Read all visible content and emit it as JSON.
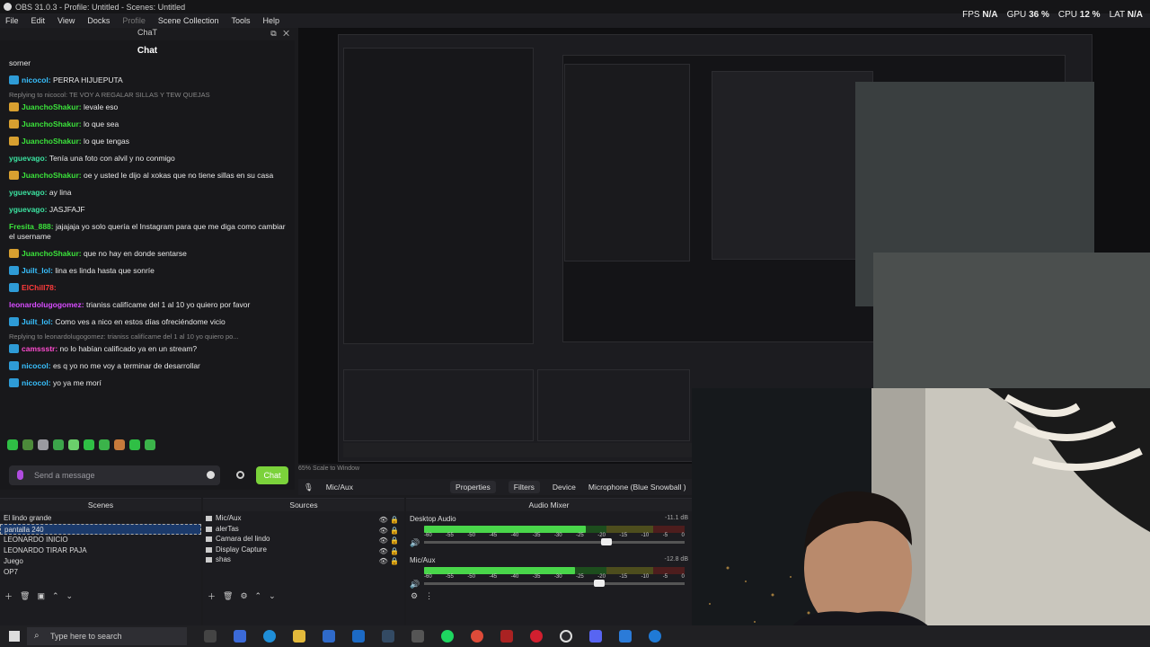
{
  "window": {
    "title": "OBS 31.0.3 - Profile: Untitled - Scenes: Untitled"
  },
  "menu": [
    "File",
    "Edit",
    "View",
    "Docks",
    "Profile",
    "Scene Collection",
    "Tools",
    "Help"
  ],
  "stats": {
    "fps_label": "FPS",
    "fps": "N/A",
    "gpu_label": "GPU",
    "gpu": "36 %",
    "cpu_label": "CPU",
    "cpu": "12 %",
    "lat_label": "LAT",
    "lat": "N/A"
  },
  "chat_dock": {
    "dock_title": "ChaT",
    "title": "Chat",
    "messages": [
      {
        "user": "",
        "text": "sorner",
        "color": "#e8e8e8",
        "badge": ""
      },
      {
        "user": "nicocol",
        "text": "PERRA HIJUEPUTA",
        "color": "#38c0ff",
        "badge": "#2e9bd6"
      },
      {
        "reply": "Replying to nicocol: TE VOY A REGALAR SILLAS Y TEW QUEJAS"
      },
      {
        "user": "JuanchoShakur",
        "text": "levale eso",
        "color": "#3be23b",
        "badge": "#d8a030"
      },
      {
        "user": "JuanchoShakur",
        "text": "lo que sea",
        "color": "#3be23b",
        "badge": "#d8a030"
      },
      {
        "user": "JuanchoShakur",
        "text": "lo que tengas",
        "color": "#3be23b",
        "badge": "#d8a030"
      },
      {
        "user": "yguevago",
        "text": "Tenía una foto con alvil y no conmigo",
        "color": "#3be2a0",
        "badge": ""
      },
      {
        "user": "JuanchoShakur",
        "text": "oe y usted le dijo al xokas que no tiene sillas en su casa",
        "color": "#3be23b",
        "badge": "#d8a030"
      },
      {
        "user": "yguevago",
        "text": "ay lina",
        "color": "#3be2a0",
        "badge": ""
      },
      {
        "user": "yguevago",
        "text": "JASJFAJF",
        "color": "#3be2a0",
        "badge": ""
      },
      {
        "user": "Fresita_888",
        "text": "jajajaja yo solo quería el Instagram para que me diga como cambiar el username",
        "color": "#3be23b",
        "badge": ""
      },
      {
        "user": "JuanchoShakur",
        "text": "que no hay en donde sentarse",
        "color": "#3be23b",
        "badge": "#d8a030"
      },
      {
        "user": "Juilt_lol",
        "text": "lina es linda hasta que sonríe",
        "color": "#38c0ff",
        "badge": "#2e9bd6"
      },
      {
        "user": "ElChill78",
        "text": "",
        "color": "#ff3b3b",
        "badge": "#2e9bd6"
      },
      {
        "user": "leonardolugogomez",
        "text": "trianiss califícame del 1 al 10 yo quiero por favor",
        "color": "#d84cff",
        "badge": ""
      },
      {
        "user": "Juilt_lol",
        "text": "Como ves a nico en estos días ofreciéndome vicio",
        "color": "#38c0ff",
        "badge": "#2e9bd6"
      },
      {
        "reply": "Replying to leonardolugogomez: trianiss califícame del 1 al 10 yo quiero po..."
      },
      {
        "user": "camssstr",
        "text": "no lo habían calificado ya en un stream?",
        "color": "#ff4cd0",
        "badge": "#2e9bd6"
      },
      {
        "user": "nicocol",
        "text": "es q yo no me voy a terminar de desarrollar",
        "color": "#38c0ff",
        "badge": "#2e9bd6"
      },
      {
        "user": "nicocol",
        "text": "yo ya me morí",
        "color": "#38c0ff",
        "badge": "#2e9bd6"
      }
    ],
    "input_placeholder": "Send a message",
    "send_label": "Chat"
  },
  "preview_tabs": {
    "scale_label": "65% Scale to Window",
    "source_label": "Mic/Aux",
    "properties": "Properties",
    "filters": "Filters",
    "device": "Device",
    "device_value": "Microphone (Blue Snowball )"
  },
  "scenes": {
    "title": "Scenes",
    "items": [
      "El lindo grande",
      "pantalla 240",
      "LEONARDO INICIO",
      "LEONARDO TIRAR PAJA",
      "Juego",
      "OP7"
    ],
    "selected": 1
  },
  "sources": {
    "title": "Sources",
    "items": [
      "Mic/Aux",
      "alerTas",
      "Camara del lindo",
      "Display Capture",
      "shas"
    ]
  },
  "mixer": {
    "title": "Audio Mixer",
    "channels": [
      {
        "name": "Desktop Audio",
        "db": "-11.1 dB",
        "level": 0.62,
        "volume": 0.68
      },
      {
        "name": "Mic/Aux",
        "db": "-12.8 dB",
        "level": 0.58,
        "volume": 0.65
      }
    ],
    "ticks": [
      "-60",
      "-55",
      "-50",
      "-45",
      "-40",
      "-35",
      "-30",
      "-25",
      "-20",
      "-15",
      "-10",
      "-5",
      "0"
    ]
  },
  "taskbar": {
    "search_placeholder": "Type here to search"
  },
  "colors": {
    "accent_green": "#7bd23b",
    "selected_blue": "#1b3a6b",
    "purple": "#b04ce0"
  }
}
